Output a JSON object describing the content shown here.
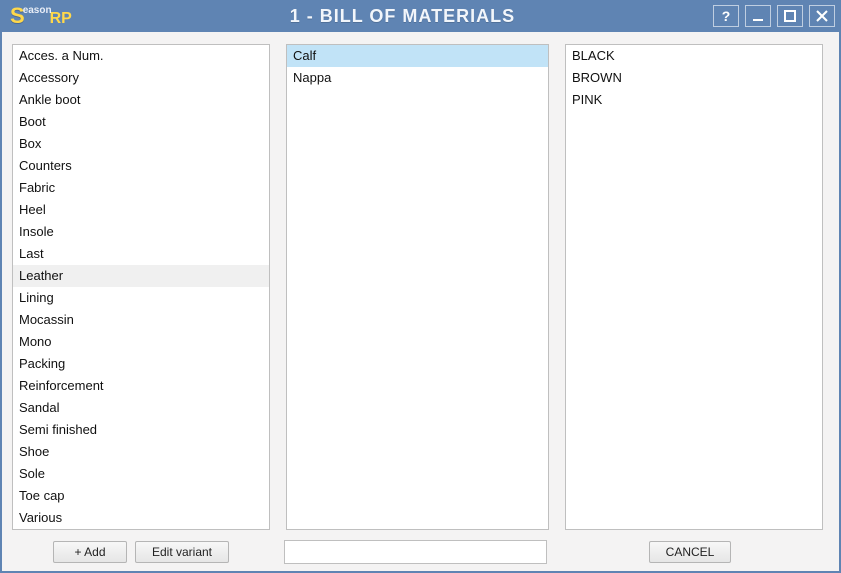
{
  "window": {
    "logo_letter": "S",
    "logo_small": "eason",
    "logo_suffix": "RP",
    "title": "1 - BILL OF MATERIALS"
  },
  "lists": {
    "categories": [
      "Acces. a Num.",
      "Accessory",
      "Ankle boot",
      "Boot",
      "Box",
      "Counters",
      "Fabric",
      "Heel",
      "Insole",
      "Last",
      "Leather",
      "Lining",
      "Mocassin",
      "Mono",
      "Packing",
      "Reinforcement",
      "Sandal",
      "Semi finished",
      "Shoe",
      "Sole",
      "Toe cap",
      "Various"
    ],
    "categories_hovered_index": 10,
    "materials": [
      "Calf",
      "Nappa"
    ],
    "materials_selected_index": 0,
    "colors": [
      "BLACK",
      "BROWN",
      "PINK"
    ]
  },
  "footer": {
    "add_label": "+ Add",
    "edit_label": "Edit variant",
    "input_value": "",
    "cancel_label": "CANCEL"
  }
}
